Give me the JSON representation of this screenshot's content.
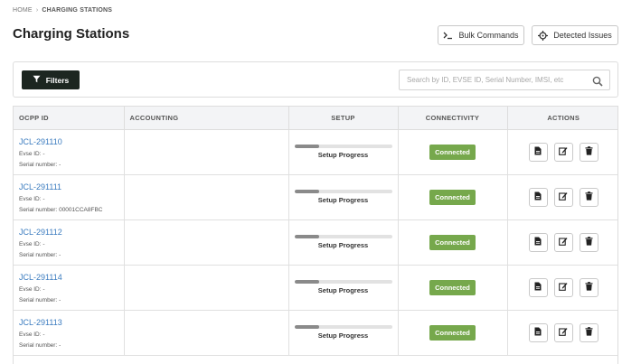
{
  "breadcrumb": {
    "home": "HOME",
    "separator": "›",
    "current": "CHARGING STATIONS"
  },
  "page": {
    "title": "Charging Stations"
  },
  "header_buttons": {
    "bulk_commands": "Bulk Commands",
    "detected_issues": "Detected Issues"
  },
  "filters": {
    "button_label": "Filters",
    "search_placeholder": "Search by ID, EVSE ID, Serial Number, IMSI, etc"
  },
  "table": {
    "columns": [
      "OCPP ID",
      "ACCOUNTING",
      "SETUP",
      "CONNECTIVITY",
      "ACTIONS"
    ],
    "rows": [
      {
        "ocpp_id": "JCL-291110",
        "evse": "Evse ID: -",
        "serial": "Serial number: -",
        "setup_label": "Setup Progress",
        "setup_progress": 0.25,
        "status": "Connected"
      },
      {
        "ocpp_id": "JCL-291111",
        "evse": "Evse ID: -",
        "serial": "Serial number: 00001CCA8FBC",
        "setup_label": "Setup Progress",
        "setup_progress": 0.25,
        "status": "Connected"
      },
      {
        "ocpp_id": "JCL-291112",
        "evse": "Evse ID: -",
        "serial": "Serial number: -",
        "setup_label": "Setup Progress",
        "setup_progress": 0.25,
        "status": "Connected"
      },
      {
        "ocpp_id": "JCL-291114",
        "evse": "Evse ID: -",
        "serial": "Serial number: -",
        "setup_label": "Setup Progress",
        "setup_progress": 0.25,
        "status": "Connected"
      },
      {
        "ocpp_id": "JCL-291113",
        "evse": "Evse ID: -",
        "serial": "Serial number: -",
        "setup_label": "Setup Progress",
        "setup_progress": 0.25,
        "status": "Connected"
      }
    ]
  },
  "colors": {
    "filter_button": "#1c2620",
    "connected_badge": "#76a84c",
    "link": "#3a7bbf",
    "progress_fill": "#8a8a8a"
  },
  "icons": {
    "bulk": "terminal-icon",
    "issues": "crosshair-icon",
    "filter": "funnel-icon",
    "search": "search-icon",
    "row_actions": [
      "document-icon",
      "edit-icon",
      "trash-icon"
    ]
  }
}
